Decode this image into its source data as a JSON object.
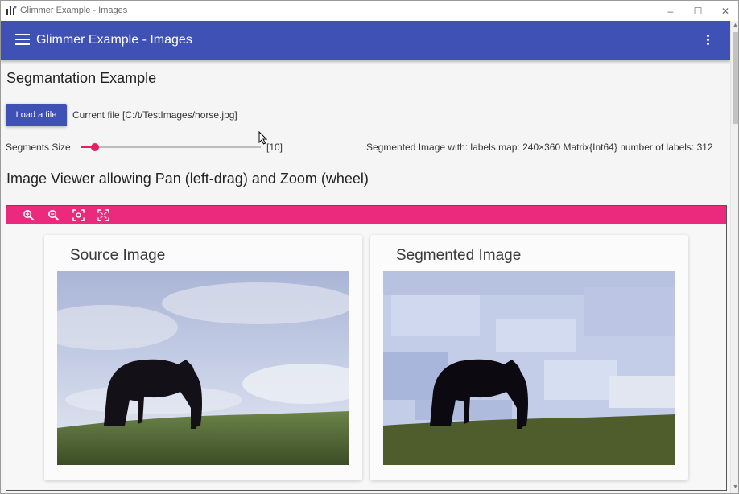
{
  "window": {
    "title": "Glimmer Example - Images",
    "controls": {
      "minimize": "–",
      "maximize": "☐",
      "close": "✕"
    }
  },
  "appbar": {
    "title": "Glimmer Example - Images",
    "menu_icon": "hamburger-menu-icon",
    "more_icon": "more-vert-icon"
  },
  "segmentation": {
    "heading": "Segmantation Example",
    "load_button": "Load a file",
    "current_file": "Current file [C:/t/TestImages/horse.jpg]",
    "segments_label": "Segments Size",
    "slider_fraction": 0.08,
    "segments_value": "[10]",
    "info": "Segmented Image with: labels map: 240×360 Matrix{Int64} number of labels: 312"
  },
  "viewer": {
    "heading": "Image Viewer allowing Pan (left-drag) and Zoom (wheel)",
    "toolbar_color": "#ec2a7d",
    "tools": [
      "zoom-in-icon",
      "zoom-out-icon",
      "fit-view-icon",
      "fullscreen-icon"
    ],
    "cards": [
      {
        "title": "Source Image"
      },
      {
        "title": "Segmented Image"
      }
    ]
  },
  "colors": {
    "primary": "#3f51b5",
    "accent": "#e91e63"
  }
}
